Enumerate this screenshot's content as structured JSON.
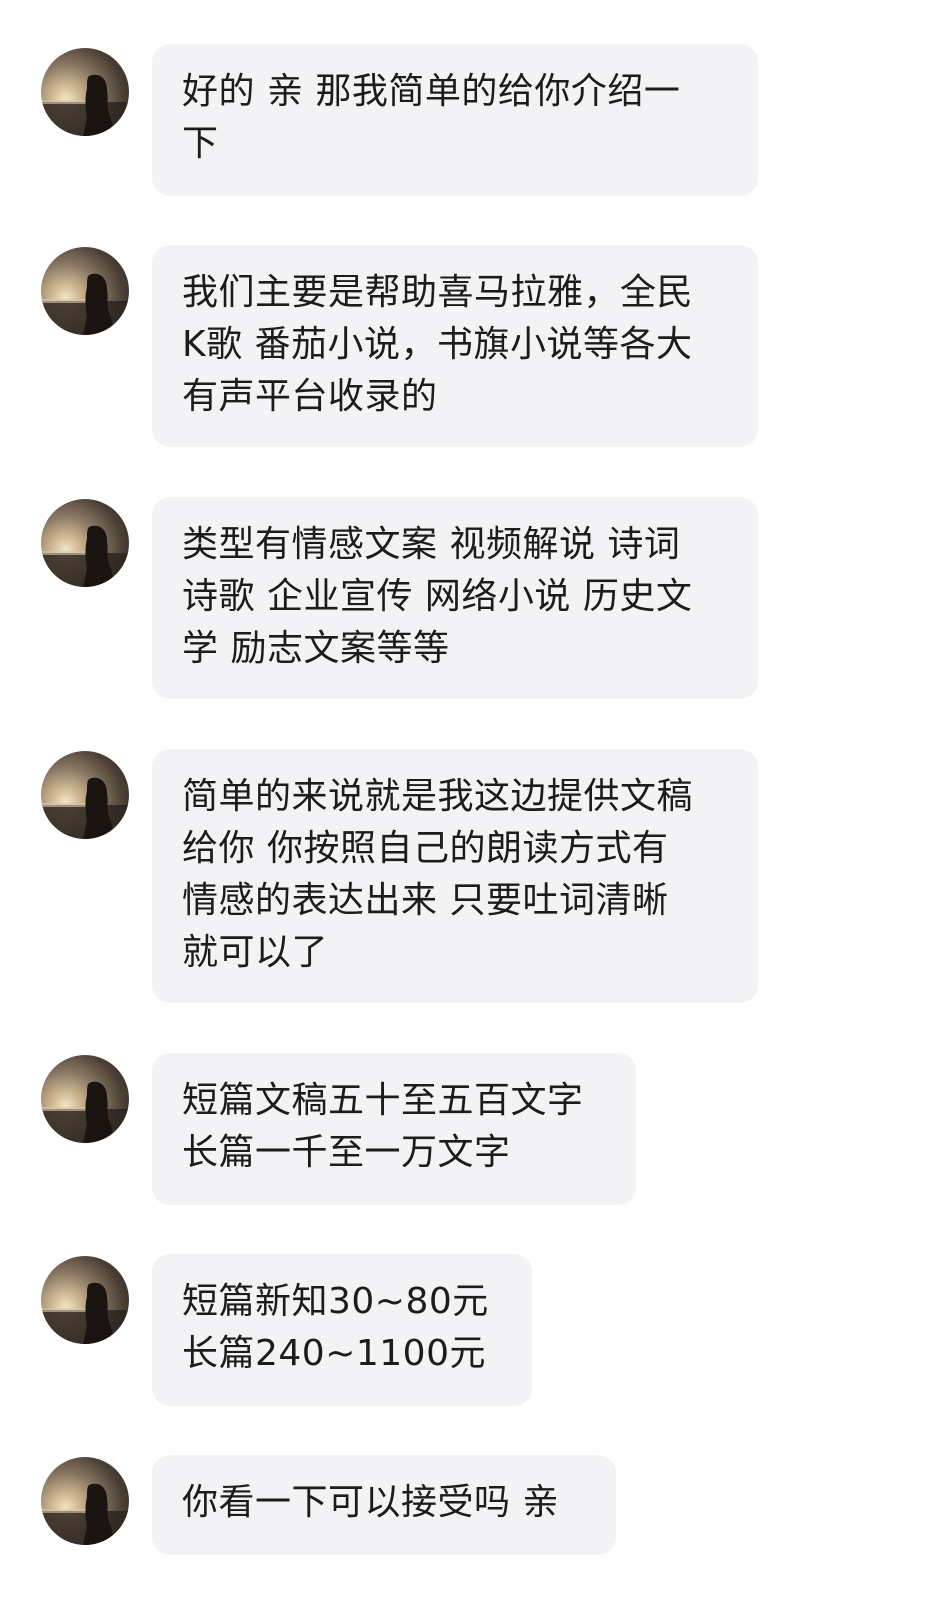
{
  "messages": [
    {
      "lines": [
        "好的 亲 那我简单的给你介绍一",
        "下"
      ]
    },
    {
      "lines": [
        "我们主要是帮助喜马拉雅，全民",
        "K歌 番茄小说，书旗小说等各大",
        "有声平台收录的"
      ]
    },
    {
      "lines": [
        "类型有情感文案 视频解说 诗词",
        "诗歌 企业宣传 网络小说 历史文",
        "学 励志文案等等"
      ]
    },
    {
      "lines": [
        "简单的来说就是我这边提供文稿",
        "给你 你按照自己的朗读方式有",
        "情感的表达出来 只要吐词清晰",
        "就可以了"
      ]
    },
    {
      "lines": [
        "短篇文稿五十至五百文字",
        "长篇一千至一万文字"
      ]
    },
    {
      "lines": [
        "短篇新知30~80元",
        "长篇240~1100元"
      ]
    },
    {
      "lines": [
        "你看一下可以接受吗 亲"
      ]
    }
  ],
  "colors": {
    "bubble_bg": "#f3f3f5",
    "text": "#1c1c1c",
    "background": "#ffffff"
  },
  "icons": {
    "avatar": "avatar-sunset-silhouette"
  }
}
